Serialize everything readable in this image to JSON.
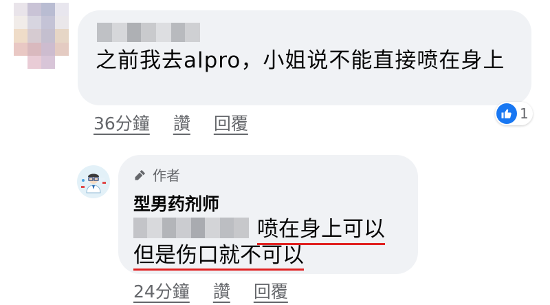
{
  "comment": {
    "text": "之前我去alpro，小姐说不能直接喷在身上",
    "actions": {
      "time": "36分鐘",
      "like": "讚",
      "reply": "回覆"
    },
    "reaction_count": "1",
    "reaction_icon": "thumbs-up-icon"
  },
  "reply": {
    "author_badge": "作者",
    "author_badge_icon": "microphone-icon",
    "name": "型男药剂师",
    "line1_highlight": "喷在身上可以",
    "line2": "但是伤口就不可以",
    "actions": {
      "time": "24分鐘",
      "like": "讚",
      "reply": "回覆"
    }
  },
  "colors": {
    "bubble": "#f0f2f5",
    "meta_text": "#65676b",
    "like_blue": "#1877f2",
    "underline_red": "#e02020"
  }
}
